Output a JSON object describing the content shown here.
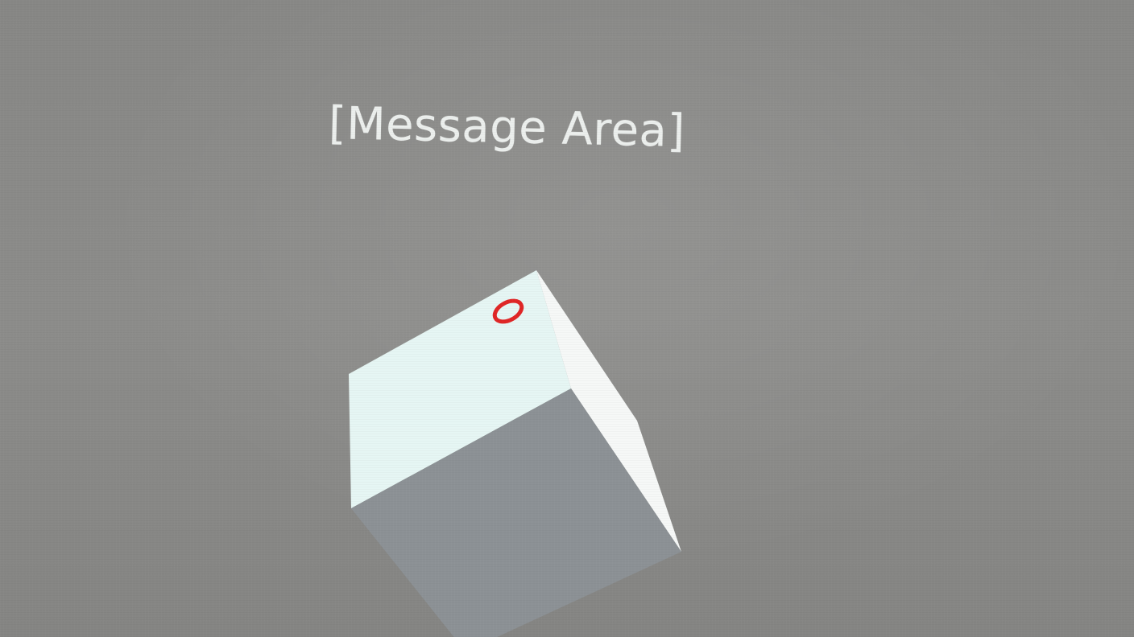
{
  "scene": {
    "message_area": "[Message Area]"
  },
  "colors": {
    "background": "#898987",
    "message_text": "#ecefed",
    "cube_top": "#e6f6f4",
    "cube_side": "#f6f8f7",
    "cube_front": "#8c9195",
    "marker": "#e02626"
  },
  "icons": {
    "cube": "cube-hologram-icon",
    "marker": "ring-marker-icon"
  }
}
